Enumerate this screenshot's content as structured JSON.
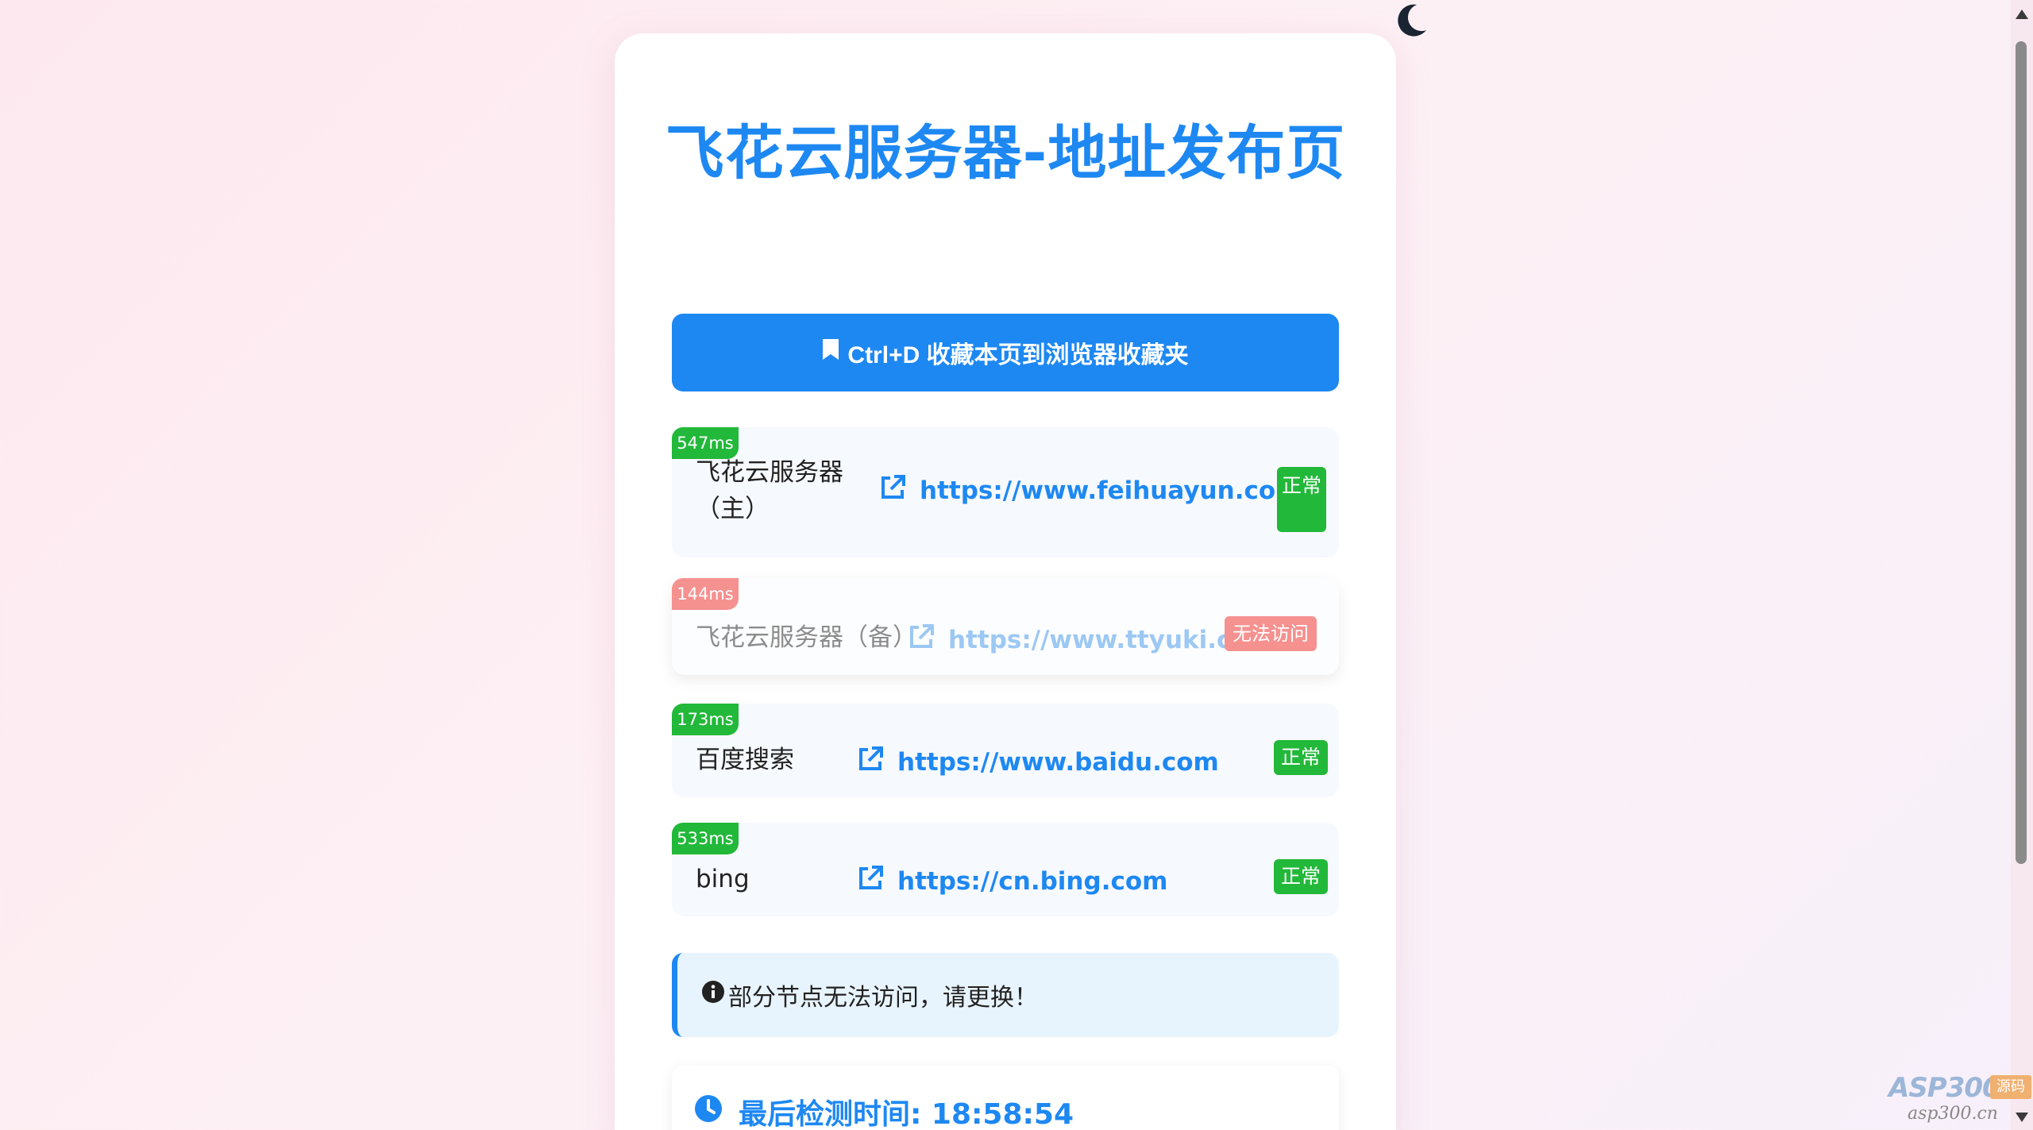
{
  "page": {
    "title": "飞花云服务器-地址发布页",
    "bookmark_button": "Ctrl+D 收藏本页到浏览器收藏夹"
  },
  "nodes": [
    {
      "latency": "547ms",
      "name": "飞花云服务器（主）",
      "url": "https://www.feihuayun.com",
      "status": "正常",
      "state": "ok"
    },
    {
      "latency": "144ms",
      "name": "飞花云服务器（备）",
      "url": "https://www.ttyuki.cn",
      "status": "无法访问",
      "state": "down"
    },
    {
      "latency": "173ms",
      "name": "百度搜索",
      "url": "https://www.baidu.com",
      "status": "正常",
      "state": "ok"
    },
    {
      "latency": "533ms",
      "name": "bing",
      "url": "https://cn.bing.com",
      "status": "正常",
      "state": "ok"
    }
  ],
  "notice": {
    "text": "部分节点无法访问，请更换！"
  },
  "check": {
    "label": "最后检测时间: 18:58:54"
  },
  "icons": {
    "theme_toggle": "moon-icon",
    "bookmark": "bookmark-icon",
    "external_link": "external-link-icon",
    "info": "info-circle-icon",
    "clock": "clock-icon"
  },
  "watermark": {
    "brand": "ASP300",
    "tag": "源码",
    "domain": "asp300.cn"
  },
  "colors": {
    "accent": "#1e88f2",
    "ok": "#22b83a",
    "bad": "#f5918f",
    "notice_bg": "#e8f4fd"
  }
}
